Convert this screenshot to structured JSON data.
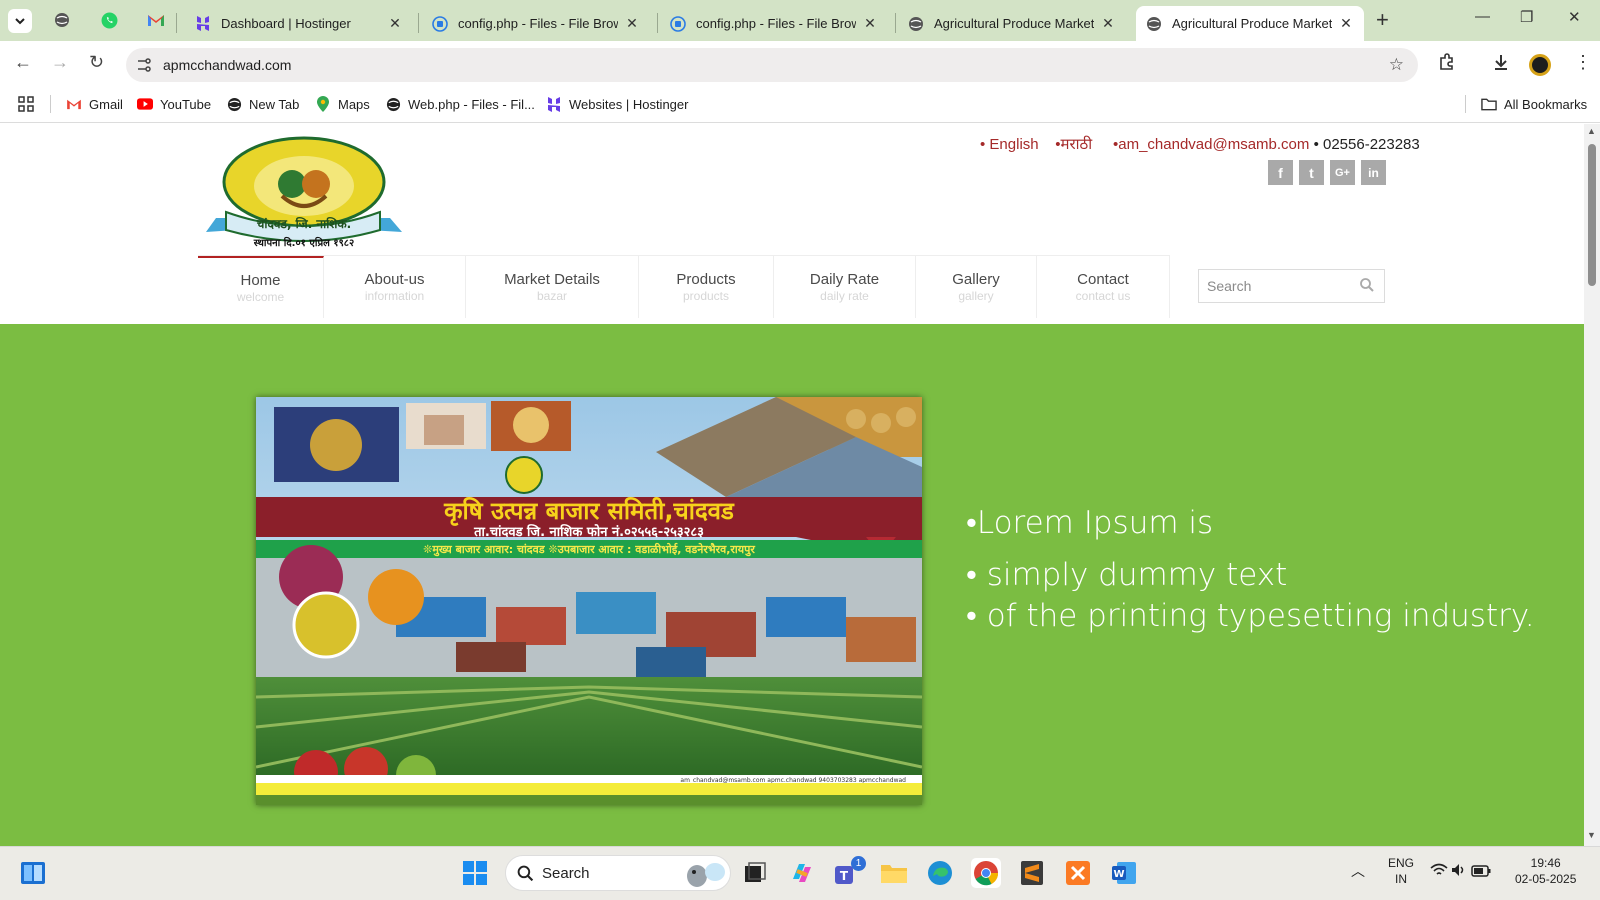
{
  "browser": {
    "tabs": [
      {
        "title": "Dashboard | Hostinger",
        "icon": "hostinger-icon"
      },
      {
        "title": "config.php - Files - File Brows",
        "icon": "file-browser-icon"
      },
      {
        "title": "config.php - Files - File Brows",
        "icon": "file-browser-icon"
      },
      {
        "title": "Agricultural Produce Market C",
        "icon": "globe-icon"
      },
      {
        "title": "Agricultural Produce Market C",
        "icon": "globe-icon",
        "active": true
      }
    ],
    "url": "apmcchandwad.com",
    "bookmarks": [
      {
        "label": "Gmail",
        "icon": "gmail-icon"
      },
      {
        "label": "YouTube",
        "icon": "youtube-icon"
      },
      {
        "label": "New Tab",
        "icon": "globe-icon"
      },
      {
        "label": "Maps",
        "icon": "maps-icon"
      },
      {
        "label": "Web.php - Files - Fil...",
        "icon": "globe-icon"
      },
      {
        "label": "Websites | Hostinger",
        "icon": "hostinger-icon"
      }
    ],
    "all_bookmarks": "All Bookmarks"
  },
  "site": {
    "lang_en": "• English",
    "lang_mr": "•मराठी",
    "email": "•am_chandvad@msamb.com",
    "phone": "• 02556-223283",
    "social": [
      {
        "name": "facebook",
        "glyph": "f"
      },
      {
        "name": "twitter",
        "glyph": "t"
      },
      {
        "name": "google-plus",
        "glyph": "G+"
      },
      {
        "name": "linkedin",
        "glyph": "in"
      }
    ],
    "logo": {
      "top_text": "कृषि उत्पन्न बाजार समिति",
      "ribbon": "चांदवड, जि. नाशिक.",
      "est": "स्थापना दि.०१ एप्रिल १९८२"
    },
    "nav": [
      {
        "title": "Home",
        "sub": "welcome",
        "active": true
      },
      {
        "title": "About-us",
        "sub": "information"
      },
      {
        "title": "Market Details",
        "sub": "bazar"
      },
      {
        "title": "Products",
        "sub": "products"
      },
      {
        "title": "Daily Rate",
        "sub": "daily rate"
      },
      {
        "title": "Gallery",
        "sub": "gallery"
      },
      {
        "title": "Contact",
        "sub": "contact us"
      }
    ],
    "search_placeholder": "Search",
    "banner": {
      "title": "कृषि उत्पन्न बाजार समिती,चांदवड",
      "subtitle": "ता.चांदवड जि. नाशिक  फोन नं.०२५५६-२५३२८३",
      "markets": "❊मुख्य बाजार आवार: चांदवड ❊उपबाजार आवार : वडाळीभोई, वडनेरभैरव,रायपुर",
      "footer": "am_chandvad@msamb.com   apmc.chandwad   9403703283   apmcchandwad"
    },
    "hero_lines": [
      "•Lorem Ipsum is",
      "• simply dummy text",
      "• of the printing typesetting industry."
    ],
    "colors": {
      "hero_bg": "#7bbd42",
      "accent": "#b22222"
    }
  },
  "taskbar": {
    "search": "Search",
    "lang": "ENG",
    "region": "IN",
    "time": "19:46",
    "date": "02-05-2025",
    "teams_badge": "1"
  }
}
